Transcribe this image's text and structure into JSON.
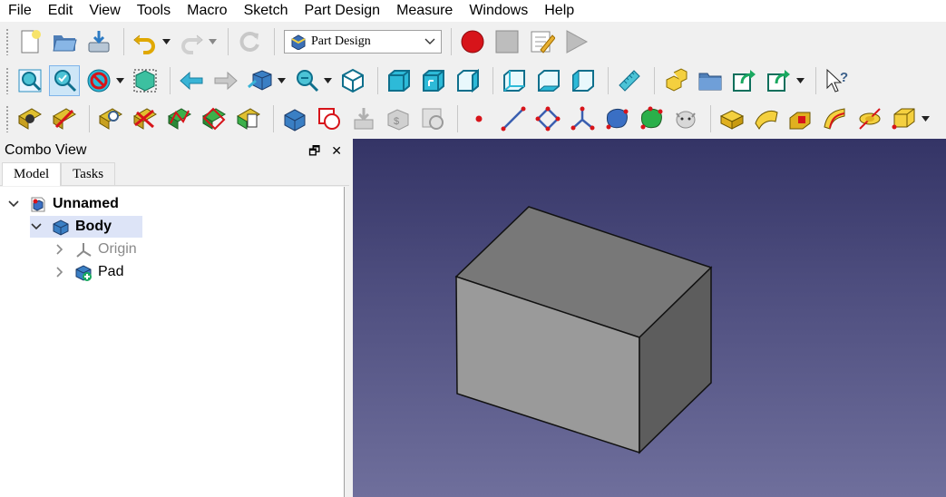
{
  "menu": [
    "File",
    "Edit",
    "View",
    "Tools",
    "Macro",
    "Sketch",
    "Part Design",
    "Measure",
    "Windows",
    "Help"
  ],
  "toolbar": {
    "workbench": "Part Design"
  },
  "combo": {
    "title": "Combo View",
    "float_glyph": "🗗",
    "close_glyph": "✕",
    "tabs": [
      "Model",
      "Tasks"
    ]
  },
  "tree": {
    "document": "Unnamed",
    "body": "Body",
    "origin": "Origin",
    "pad": "Pad"
  },
  "colors": {
    "accent_selection": "#dde4f7",
    "viewport_top": "#343466",
    "viewport_bottom": "#6f6f9c",
    "record": "#d7141a"
  },
  "icons": {
    "toolbar1": [
      "new-document-icon",
      "open-folder-icon",
      "save-icon",
      "undo-icon",
      "redo-icon",
      "refresh-icon",
      "record-macro-icon",
      "stop-macro-icon",
      "edit-macro-icon",
      "execute-macro-icon"
    ],
    "toolbar2": [
      "fit-all-icon",
      "fit-selection-icon",
      "draw-style-icon",
      "bounding-box-icon",
      "back-icon",
      "forward-icon",
      "std-view-icon",
      "zoom-icon",
      "isometric-icon",
      "front-view-icon",
      "top-view-icon",
      "right-view-icon",
      "rear-view-icon",
      "bottom-view-icon",
      "left-view-icon",
      "measure-distance-icon",
      "part-icon",
      "group-icon",
      "link-icon",
      "link-actions-icon",
      "whats-this-icon"
    ],
    "toolbar3": [
      "sketch-new-icon",
      "sketch-edit-icon",
      "sketch-map-icon",
      "sketch-reorient-icon",
      "sketch-validate-icon",
      "sketch-merge-icon",
      "sketch-mirror-icon",
      "body-icon",
      "shape-binder-icon",
      "subshape-binder-icon",
      "clone-icon",
      "new-sketch-icon",
      "datum-point-icon",
      "datum-line-icon",
      "datum-plane-icon",
      "local-cs-icon",
      "shapebinder-icon",
      "subshapebinder-icon",
      "clone-animal-icon",
      "pad-icon",
      "revolution-icon",
      "additive-loft-icon",
      "additive-pipe-icon",
      "additive-helix-icon",
      "additive-primitive-icon"
    ]
  }
}
